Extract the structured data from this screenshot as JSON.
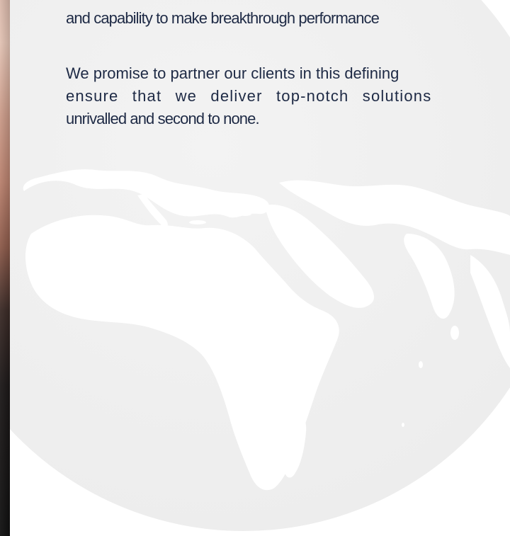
{
  "content": {
    "line_top": "and capability to make breakthrough performance",
    "para_line_1": "We promise to partner our clients in this defining",
    "para_line_2": "ensure that we deliver top-notch solutions",
    "para_line_3": "unrivalled and second to none."
  },
  "colors": {
    "text": "#1e2a45",
    "globe_fill": "#f0f0f0",
    "land_fill": "#ffffff",
    "background": "#ffffff"
  },
  "icons": {
    "background_graphic": "world-globe"
  }
}
